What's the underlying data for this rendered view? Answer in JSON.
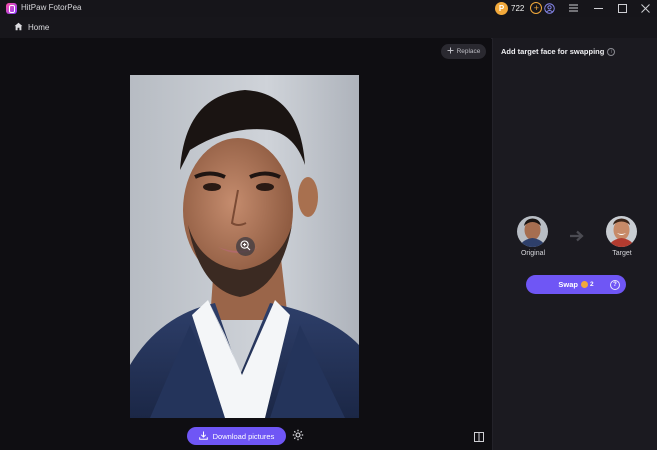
{
  "app": {
    "title": "HitPaw FotorPea"
  },
  "header": {
    "coin_count": "722",
    "icons": [
      "coin-icon",
      "add-coin-icon",
      "account-icon",
      "menu-icon",
      "minimize-icon",
      "maximize-icon",
      "close-icon"
    ]
  },
  "nav": {
    "home_label": "Home"
  },
  "canvas": {
    "replace_label": "Replace",
    "download_label": "Download pictures"
  },
  "panel": {
    "title": "Add target face for swapping",
    "original_label": "Original",
    "target_label": "Target",
    "swap_label": "Swap",
    "swap_cost": "2"
  },
  "colors": {
    "accent": "#6f56f5",
    "coin": "#f2a93b",
    "background": "#0f0e12",
    "panel": "#1b1a20"
  }
}
